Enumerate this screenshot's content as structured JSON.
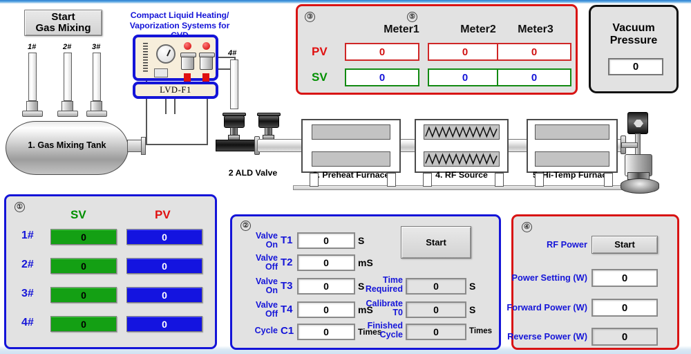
{
  "header": {
    "start_gas_button": "Start\nGas Mixing",
    "system_title": "Compact Liquid Heating/\nVaporization Systems for CVD"
  },
  "meter_panel": {
    "marker_left": "③",
    "marker_mid": "⑤",
    "columns": [
      "Meter1",
      "Meter2",
      "Meter3"
    ],
    "rows": [
      {
        "label": "PV",
        "label_color": "#e01010",
        "values": [
          "0",
          "0",
          "0"
        ]
      },
      {
        "label": "SV",
        "label_color": "#009000",
        "values": [
          "0",
          "0",
          "0"
        ]
      }
    ]
  },
  "vacuum": {
    "title": "Vacuum\nPressure",
    "value": "0"
  },
  "panel1": {
    "marker": "①",
    "head_sv": "SV",
    "head_pv": "PV",
    "rows": [
      {
        "label": "1#",
        "sv": "0",
        "pv": "0"
      },
      {
        "label": "2#",
        "sv": "0",
        "pv": "0"
      },
      {
        "label": "3#",
        "sv": "0",
        "pv": "0"
      },
      {
        "label": "4#",
        "sv": "0",
        "pv": "0"
      }
    ]
  },
  "panel2": {
    "marker": "②",
    "start_button": "Start",
    "rows": [
      {
        "label": "Valve\nOn",
        "tag": "T1",
        "value": "0",
        "unit": "S"
      },
      {
        "label": "Valve\nOff",
        "tag": "T2",
        "value": "0",
        "unit": "mS"
      },
      {
        "label": "Valve\nOn",
        "tag": "T3",
        "value": "0",
        "unit": "S"
      },
      {
        "label": "Valve\nOff",
        "tag": "T4",
        "value": "0",
        "unit": "mS"
      },
      {
        "label": "Cycle",
        "tag": "C1",
        "value": "0",
        "unit": "Times"
      }
    ],
    "readouts": [
      {
        "label": "Time\nRequired",
        "value": "0",
        "unit": "S"
      },
      {
        "label": "Calibrate\nT0",
        "value": "0",
        "unit": "S"
      },
      {
        "label": "Finished\nCycle",
        "value": "0",
        "unit": "Times"
      }
    ]
  },
  "panel4": {
    "marker": "④",
    "rf_power_label": "RF Power",
    "rf_start_button": "Start",
    "fields": [
      {
        "label": "Power Setting (W)",
        "value": "0"
      },
      {
        "label": "Forward Power (W)",
        "value": "0"
      },
      {
        "label": "Reverse Power (W)",
        "value": "0"
      }
    ]
  },
  "schematic": {
    "gas_inlets": [
      "1#",
      "2#",
      "3#"
    ],
    "liquid_inlet": "4#",
    "tank_label": "1. Gas Mixing Tank",
    "lvd_unit_name": "LVD-F1",
    "valve_label": "2 ALD Valve",
    "furnaces": [
      {
        "label": "3. Preheat Furnace",
        "style": "block"
      },
      {
        "label": "4. RF Source",
        "style": "coil"
      },
      {
        "label": "5. Hi-Temp Furnace",
        "style": "block"
      }
    ]
  },
  "colors": {
    "accent_blue": "#1515d8",
    "accent_red": "#d81414",
    "accent_green": "#009000",
    "panel_bg": "#e2e2e2",
    "sv_bar": "#14a014",
    "pv_bar": "#1414e0"
  }
}
